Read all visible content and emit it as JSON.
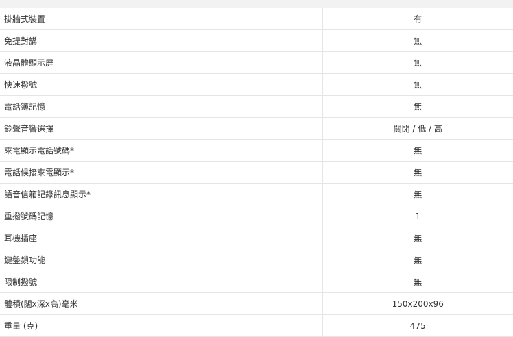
{
  "specs": {
    "rows": [
      {
        "label": "掛牆式裝置",
        "value": "有"
      },
      {
        "label": "免提對講",
        "value": "無"
      },
      {
        "label": "液晶體顯示屏",
        "value": "無"
      },
      {
        "label": "快速撥號",
        "value": "無"
      },
      {
        "label": "電話簿記憶",
        "value": "無"
      },
      {
        "label": "鈴聲音響選擇",
        "value": "關閉 / 低 / 高"
      },
      {
        "label": "來電顯示電話號碼*",
        "value": "無"
      },
      {
        "label": "電話候接來電顯示*",
        "value": "無"
      },
      {
        "label": "語音信箱記錄訊息顯示*",
        "value": "無"
      },
      {
        "label": "重撥號碼記憶",
        "value": "1"
      },
      {
        "label": "耳機插座",
        "value": "無"
      },
      {
        "label": "鍵盤鎖功能",
        "value": "無"
      },
      {
        "label": "限制撥號",
        "value": "無"
      },
      {
        "label": "體積(闊x深x高)毫米",
        "value": "150x200x96"
      },
      {
        "label": "重量 (克)",
        "value": "475"
      }
    ]
  }
}
